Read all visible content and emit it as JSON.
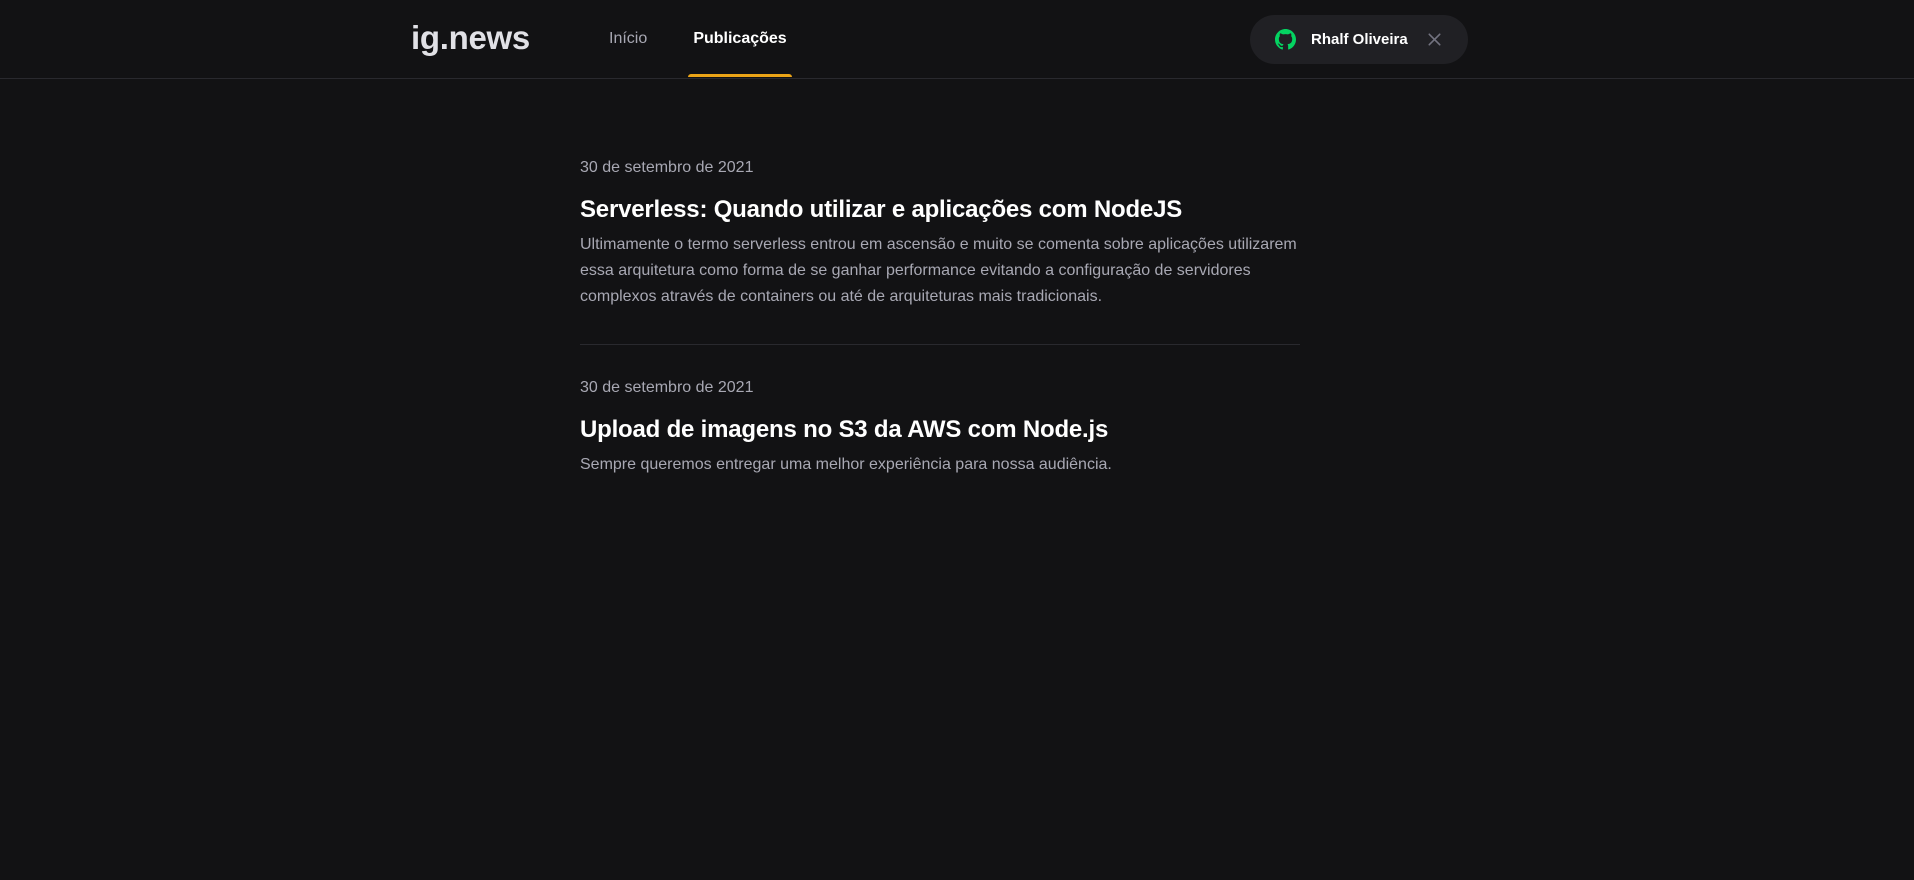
{
  "header": {
    "logo": "ig.news",
    "nav": [
      {
        "label": "Início",
        "active": false
      },
      {
        "label": "Publicações",
        "active": true
      }
    ],
    "user": {
      "name": "Rhalf Oliveira",
      "icon": "github-icon",
      "close_icon": "close-icon"
    }
  },
  "posts": [
    {
      "date": "30 de setembro de 2021",
      "title": "Serverless: Quando utilizar e aplicações com NodeJS",
      "excerpt": "Ultimamente o termo serverless entrou em ascensão e muito se comenta sobre aplicações utilizarem essa arquitetura como forma de se ganhar performance evitando a configuração de servidores complexos através de containers ou até de arquiteturas mais tradicionais."
    },
    {
      "date": "30 de setembro de 2021",
      "title": "Upload de imagens no S3 da AWS com Node.js",
      "excerpt": "Sempre queremos entregar uma melhor experiência para nossa audiência."
    }
  ],
  "colors": {
    "background": "#121214",
    "accent": "#eba417",
    "github_green": "#04d361",
    "muted_text": "#a8a8b3"
  }
}
